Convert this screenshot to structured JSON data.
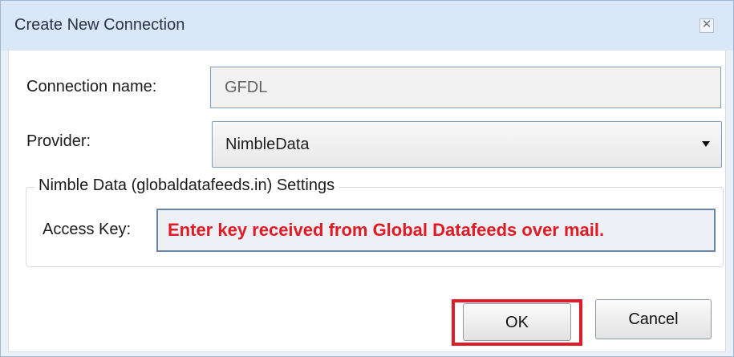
{
  "window": {
    "title": "Create New Connection",
    "close_icon_glyph": "✕"
  },
  "form": {
    "connection_name_label": "Connection name:",
    "connection_name_value": "GFDL",
    "provider_label": "Provider:",
    "provider_value": "NimbleData",
    "settings_group_title": "Nimble Data (globaldatafeeds.in) Settings",
    "access_key_label": "Access Key:",
    "access_key_value": "Enter key received from Global Datafeeds over mail."
  },
  "buttons": {
    "ok_label": "OK",
    "cancel_label": "Cancel"
  },
  "icons": {
    "close": "close-icon",
    "dropdown": "chevron-down-icon"
  },
  "colors": {
    "highlight": "#e01b2a",
    "access_key_text": "#e11a25",
    "titlebar": "#d9e7f6"
  }
}
